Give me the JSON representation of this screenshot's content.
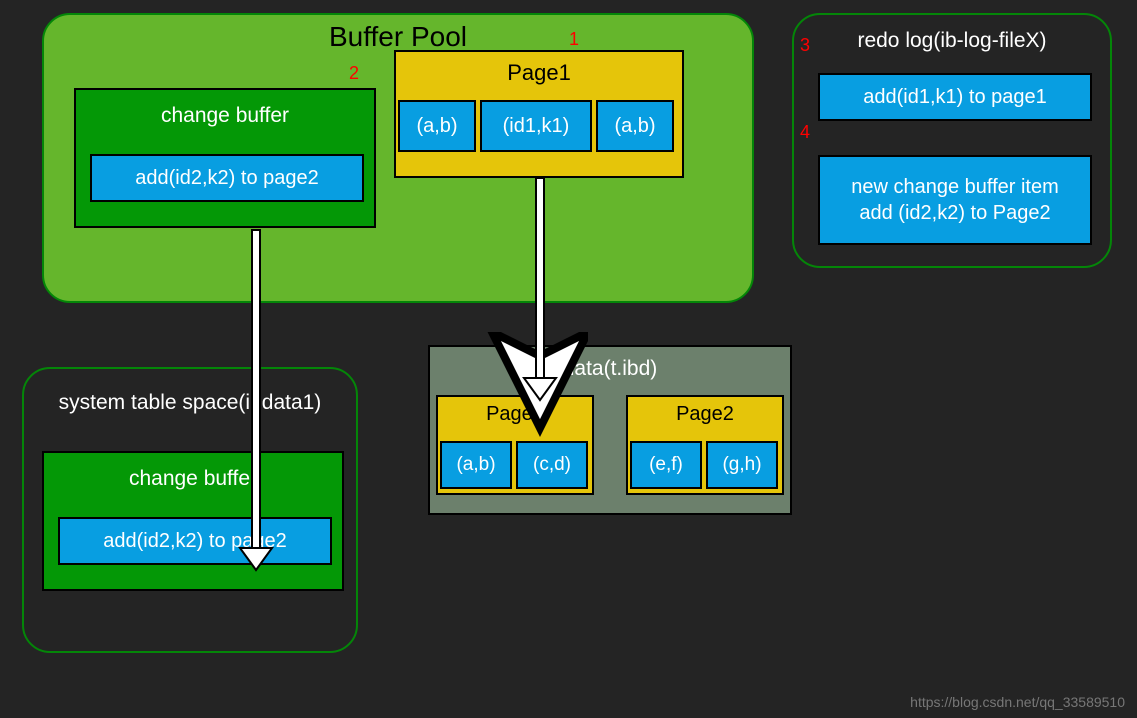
{
  "buffer_pool": {
    "title": "Buffer Pool",
    "mark1": "1",
    "mark2": "2",
    "change_buffer": {
      "title": "change buffer",
      "entry": "add(id2,k2) to page2"
    },
    "page1": {
      "title": "Page1",
      "cells": [
        "(a,b)",
        "(id1,k1)",
        "(a,b)"
      ]
    }
  },
  "redo_log": {
    "title": "redo log(ib-log-fileX)",
    "mark3": "3",
    "mark4": "4",
    "entry1": "add(id1,k1) to page1",
    "entry2_line1": "new change buffer item",
    "entry2_line2": "add (id2,k2) to Page2"
  },
  "system_space": {
    "title": "system table space(ibdata1)",
    "change_buffer": {
      "title": "change buffer",
      "entry": "add(id2,k2) to page2"
    }
  },
  "data_file": {
    "title": "data(t.ibd)",
    "page1": {
      "title": "Page1",
      "cells": [
        "(a,b)",
        "(c,d)"
      ]
    },
    "page2": {
      "title": "Page2",
      "cells": [
        "(e,f)",
        "(g,h)"
      ]
    }
  },
  "watermark": "https://blog.csdn.net/qq_33589510"
}
